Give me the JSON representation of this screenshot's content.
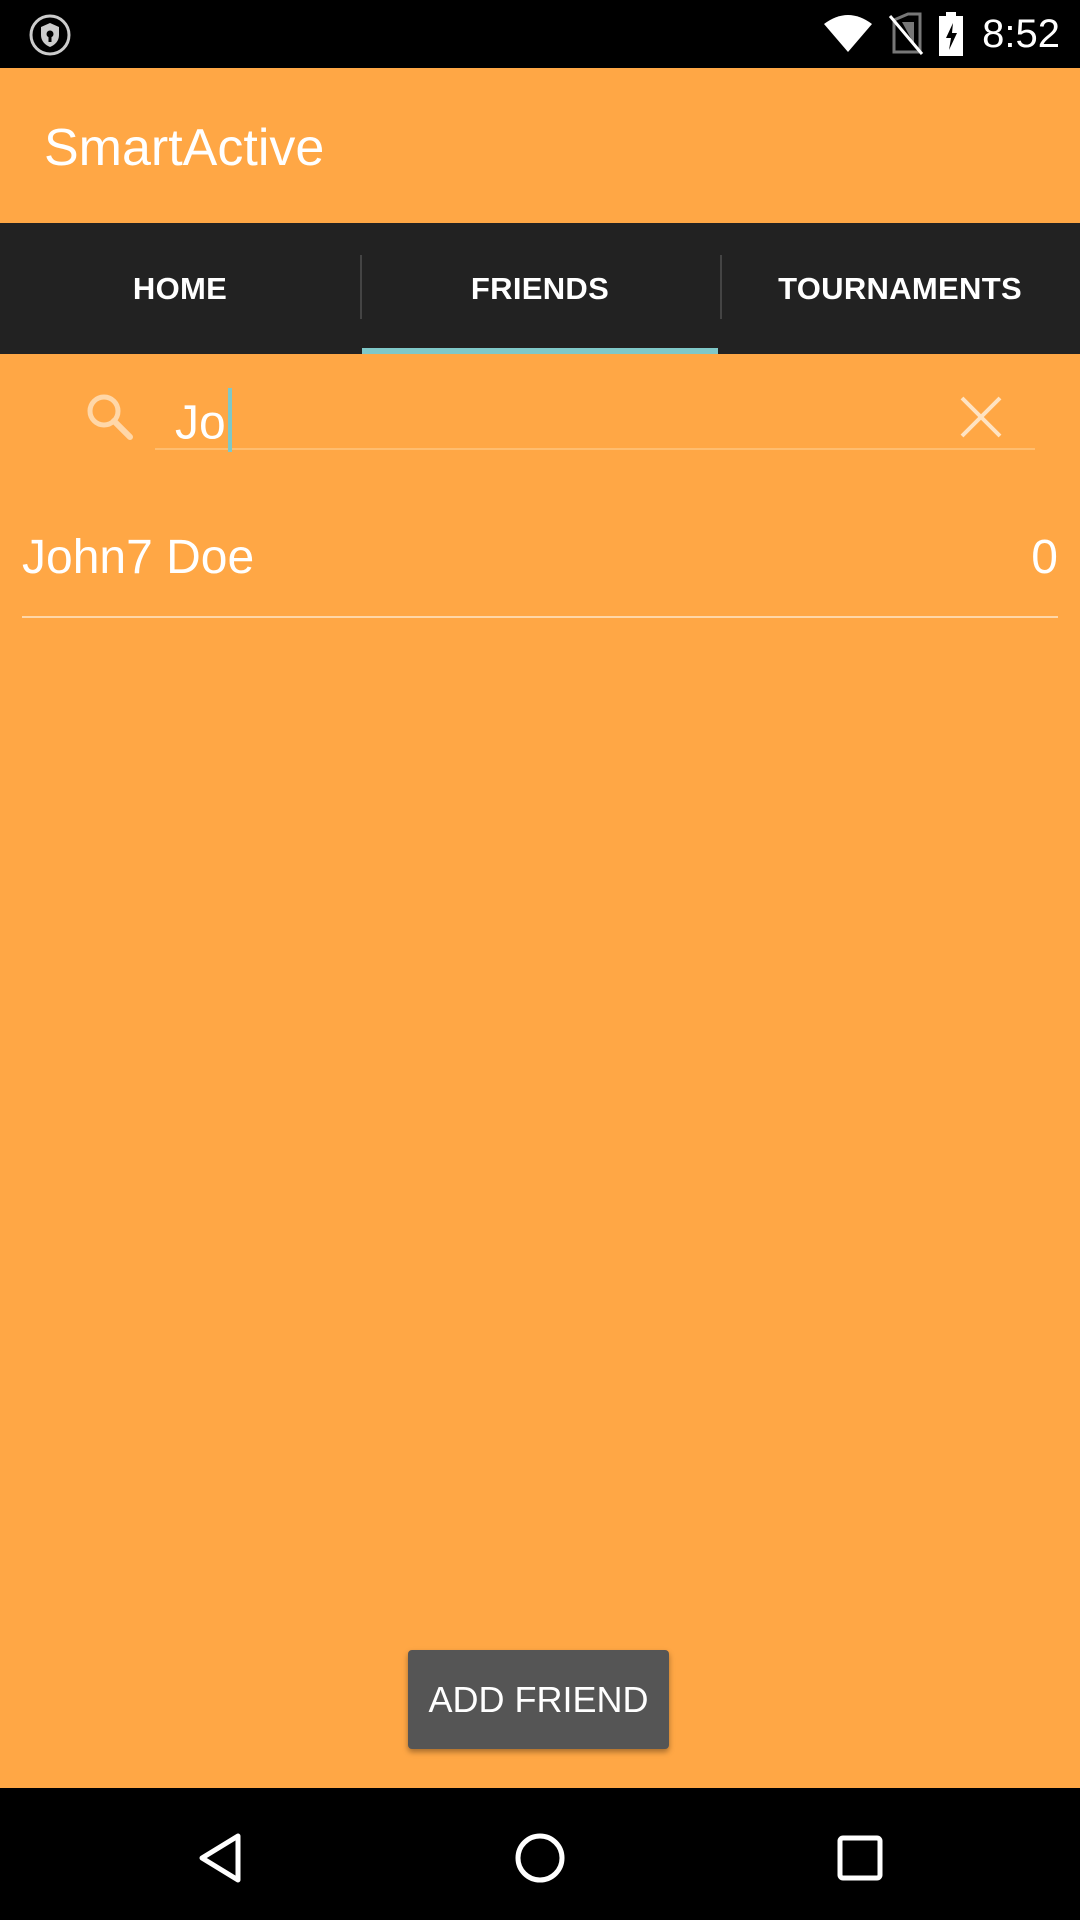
{
  "status_bar": {
    "time": "8:52",
    "icons": [
      "shield-icon",
      "wifi-icon",
      "no-sim-icon",
      "battery-charging-icon"
    ]
  },
  "app": {
    "title": "SmartActive",
    "background_color": "#FFA745"
  },
  "tabs": [
    {
      "label": "HOME",
      "active": false
    },
    {
      "label": "FRIENDS",
      "active": true
    },
    {
      "label": "TOURNAMENTS",
      "active": false
    }
  ],
  "search": {
    "value": "Jo",
    "icon": "search-icon",
    "clear_icon": "close-icon"
  },
  "friends": [
    {
      "name": "John7 Doe",
      "score": "0"
    }
  ],
  "add_friend_button": {
    "label": "ADD FRIEND"
  },
  "nav_bar": {
    "icons": [
      "back-icon",
      "home-icon",
      "recent-apps-icon"
    ]
  }
}
